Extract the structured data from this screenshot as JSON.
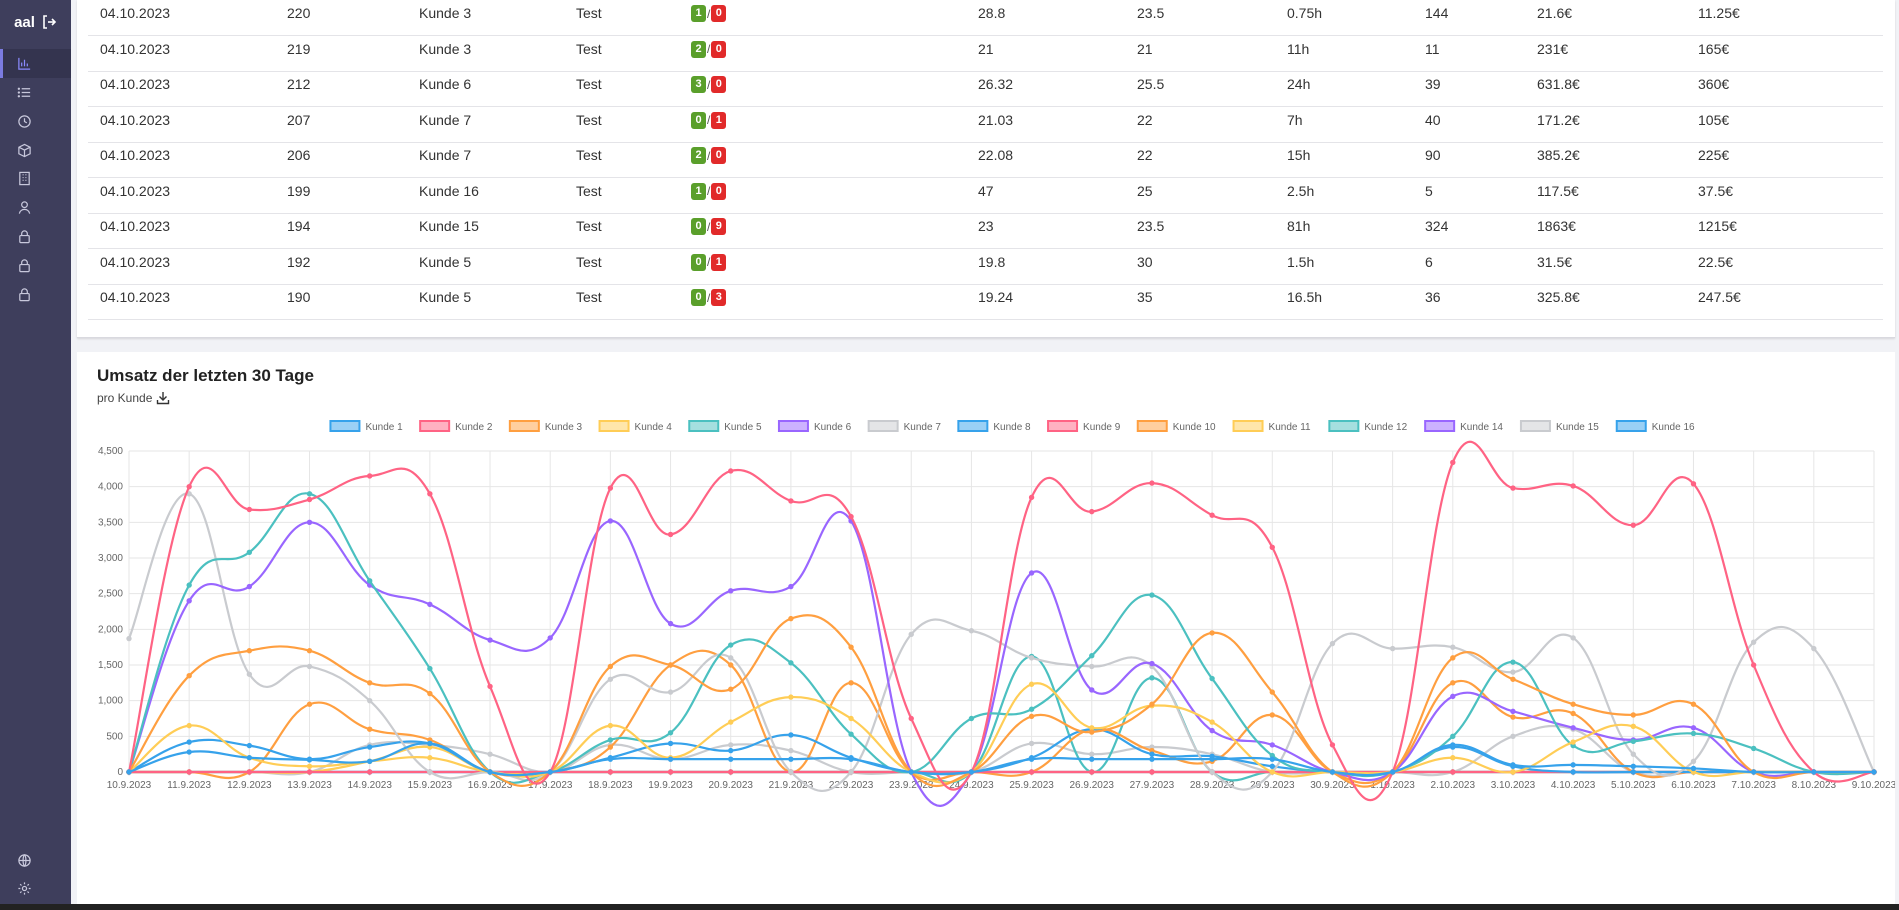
{
  "sidebar": {
    "brand": "aal",
    "items": [
      {
        "icon": "bar-chart-icon",
        "active": true
      },
      {
        "icon": "list-icon",
        "active": false
      },
      {
        "icon": "clock-icon",
        "active": false
      },
      {
        "icon": "box-icon",
        "active": false
      },
      {
        "icon": "building-icon",
        "active": false
      },
      {
        "icon": "user-icon",
        "active": false
      },
      {
        "icon": "lock-icon",
        "active": false
      },
      {
        "icon": "lock-icon",
        "active": false
      },
      {
        "icon": "lock-icon",
        "active": false
      }
    ],
    "bottom_items": [
      {
        "icon": "globe-icon"
      },
      {
        "icon": "gear-icon"
      }
    ]
  },
  "table": {
    "rows": [
      {
        "date": "04.10.2023",
        "id": "220",
        "customer": "Kunde 3",
        "type": "Test",
        "ok": "1",
        "fail": "0",
        "c1": "28.8",
        "c2": "23.5",
        "hours": "0.75h",
        "count": "144",
        "revenue": "21.6€",
        "cost": "11.25€"
      },
      {
        "date": "04.10.2023",
        "id": "219",
        "customer": "Kunde 3",
        "type": "Test",
        "ok": "2",
        "fail": "0",
        "c1": "21",
        "c2": "21",
        "hours": "11h",
        "count": "11",
        "revenue": "231€",
        "cost": "165€"
      },
      {
        "date": "04.10.2023",
        "id": "212",
        "customer": "Kunde 6",
        "type": "Test",
        "ok": "3",
        "fail": "0",
        "c1": "26.32",
        "c2": "25.5",
        "hours": "24h",
        "count": "39",
        "revenue": "631.8€",
        "cost": "360€"
      },
      {
        "date": "04.10.2023",
        "id": "207",
        "customer": "Kunde 7",
        "type": "Test",
        "ok": "0",
        "fail": "1",
        "c1": "21.03",
        "c2": "22",
        "hours": "7h",
        "count": "40",
        "revenue": "171.2€",
        "cost": "105€"
      },
      {
        "date": "04.10.2023",
        "id": "206",
        "customer": "Kunde 7",
        "type": "Test",
        "ok": "2",
        "fail": "0",
        "c1": "22.08",
        "c2": "22",
        "hours": "15h",
        "count": "90",
        "revenue": "385.2€",
        "cost": "225€"
      },
      {
        "date": "04.10.2023",
        "id": "199",
        "customer": "Kunde 16",
        "type": "Test",
        "ok": "1",
        "fail": "0",
        "c1": "47",
        "c2": "25",
        "hours": "2.5h",
        "count": "5",
        "revenue": "117.5€",
        "cost": "37.5€"
      },
      {
        "date": "04.10.2023",
        "id": "194",
        "customer": "Kunde 15",
        "type": "Test",
        "ok": "0",
        "fail": "9",
        "c1": "23",
        "c2": "23.5",
        "hours": "81h",
        "count": "324",
        "revenue": "1863€",
        "cost": "1215€"
      },
      {
        "date": "04.10.2023",
        "id": "192",
        "customer": "Kunde 5",
        "type": "Test",
        "ok": "0",
        "fail": "1",
        "c1": "19.8",
        "c2": "30",
        "hours": "1.5h",
        "count": "6",
        "revenue": "31.5€",
        "cost": "22.5€"
      },
      {
        "date": "04.10.2023",
        "id": "190",
        "customer": "Kunde 5",
        "type": "Test",
        "ok": "0",
        "fail": "3",
        "c1": "19.24",
        "c2": "35",
        "hours": "16.5h",
        "count": "36",
        "revenue": "325.8€",
        "cost": "247.5€"
      }
    ]
  },
  "chart_section": {
    "title": "Umsatz der letzten 30 Tage",
    "subtitle": "pro Kunde",
    "download_icon": "download-icon"
  },
  "chart_data": {
    "type": "line",
    "x": [
      "10.9.2023",
      "11.9.2023",
      "12.9.2023",
      "13.9.2023",
      "14.9.2023",
      "15.9.2023",
      "16.9.2023",
      "17.9.2023",
      "18.9.2023",
      "19.9.2023",
      "20.9.2023",
      "21.9.2023",
      "22.9.2023",
      "23.9.2023",
      "24.9.2023",
      "25.9.2023",
      "26.9.2023",
      "27.9.2023",
      "28.9.2023",
      "29.9.2023",
      "30.9.2023",
      "1.10.2023",
      "2.10.2023",
      "3.10.2023",
      "4.10.2023",
      "5.10.2023",
      "6.10.2023",
      "7.10.2023",
      "8.10.2023",
      "9.10.2023"
    ],
    "ylim": [
      0,
      4500
    ],
    "yticks": [
      "0",
      "500",
      "1,000",
      "1,500",
      "2,000",
      "2,500",
      "3,000",
      "3,500",
      "4,000",
      "4,500"
    ],
    "grid": true,
    "legend_position": "top",
    "series": [
      {
        "name": "Kunde 1",
        "color": "#36a2eb",
        "values": [
          0,
          280,
          200,
          170,
          150,
          400,
          0,
          0,
          180,
          180,
          180,
          180,
          180,
          0,
          0,
          180,
          180,
          180,
          180,
          180,
          0,
          0,
          380,
          100,
          100,
          80,
          50,
          0,
          0,
          0
        ]
      },
      {
        "name": "Kunde 2",
        "color": "#ff6384",
        "values": [
          0,
          4000,
          3680,
          3820,
          4150,
          3900,
          1200,
          0,
          3980,
          3330,
          4220,
          3800,
          3580,
          750,
          0,
          3850,
          3650,
          4050,
          3600,
          3150,
          380,
          0,
          4340,
          3980,
          4010,
          3460,
          4040,
          1500,
          0,
          0
        ]
      },
      {
        "name": "Kunde 3",
        "color": "#ff9f40",
        "values": [
          0,
          1350,
          1700,
          1700,
          1250,
          1100,
          0,
          0,
          1480,
          1500,
          1160,
          2150,
          1750,
          0,
          0,
          780,
          560,
          950,
          1950,
          1120,
          0,
          0,
          1600,
          1300,
          950,
          800,
          950,
          0,
          0,
          0
        ]
      },
      {
        "name": "Kunde 4",
        "color": "#ffcd56",
        "values": [
          0,
          650,
          200,
          80,
          150,
          200,
          0,
          0,
          650,
          200,
          700,
          1050,
          750,
          0,
          0,
          1230,
          620,
          930,
          700,
          0,
          0,
          0,
          200,
          0,
          420,
          640,
          0,
          0,
          0,
          0
        ]
      },
      {
        "name": "Kunde 5",
        "color": "#4bc0c0",
        "values": [
          0,
          2620,
          3080,
          3900,
          2680,
          1450,
          0,
          0,
          450,
          550,
          1780,
          1530,
          530,
          0,
          750,
          880,
          1630,
          2480,
          1310,
          230,
          0,
          0,
          500,
          1540,
          370,
          430,
          540,
          330,
          0,
          0
        ]
      },
      {
        "name": "Kunde 6",
        "color": "#9966ff",
        "values": [
          0,
          2400,
          2600,
          3500,
          2620,
          2350,
          1850,
          1880,
          3520,
          2080,
          2540,
          2600,
          3520,
          0,
          0,
          2790,
          1150,
          1520,
          580,
          380,
          0,
          0,
          1060,
          850,
          620,
          450,
          620,
          0,
          0,
          0
        ]
      },
      {
        "name": "Kunde 7",
        "color": "#c9cbcf",
        "values": [
          1870,
          3900,
          1370,
          1480,
          1000,
          0,
          0,
          0,
          1300,
          1120,
          1600,
          0,
          0,
          1930,
          1980,
          1600,
          1480,
          1480,
          0,
          0,
          1800,
          1730,
          1750,
          1400,
          1880,
          250,
          150,
          1820,
          1730,
          0
        ]
      },
      {
        "name": "Kunde 8",
        "color": "#36a2eb",
        "values": [
          0,
          420,
          370,
          180,
          350,
          400,
          0,
          0,
          200,
          400,
          300,
          520,
          200,
          0,
          0,
          200,
          600,
          250,
          220,
          80,
          0,
          0,
          350,
          80,
          0,
          0,
          0,
          0,
          0,
          0
        ]
      },
      {
        "name": "Kunde 9",
        "color": "#ff6384",
        "values": [
          0,
          0,
          0,
          0,
          0,
          0,
          0,
          0,
          0,
          0,
          0,
          0,
          0,
          0,
          0,
          0,
          0,
          0,
          0,
          0,
          0,
          0,
          0,
          0,
          0,
          0,
          0,
          0,
          0,
          0
        ]
      },
      {
        "name": "Kunde 10",
        "color": "#ff9f40",
        "values": [
          0,
          0,
          0,
          950,
          600,
          450,
          0,
          0,
          350,
          1500,
          1500,
          0,
          1250,
          0,
          0,
          0,
          600,
          300,
          150,
          800,
          0,
          0,
          1250,
          770,
          820,
          0,
          0,
          0,
          0,
          0
        ]
      },
      {
        "name": "Kunde 11",
        "color": "#ffcd56",
        "values": [
          0,
          0,
          0,
          0,
          150,
          350,
          0,
          0,
          0,
          0,
          0,
          0,
          0,
          0,
          0,
          0,
          0,
          0,
          0,
          0,
          0,
          0,
          0,
          0,
          0,
          0,
          0,
          0,
          0,
          0
        ]
      },
      {
        "name": "Kunde 12",
        "color": "#4bc0c0",
        "values": [
          0,
          0,
          0,
          0,
          0,
          0,
          0,
          0,
          0,
          0,
          0,
          0,
          0,
          0,
          0,
          1620,
          0,
          1320,
          0,
          0,
          0,
          0,
          0,
          0,
          0,
          0,
          0,
          0,
          0,
          0
        ]
      },
      {
        "name": "Kunde 14",
        "color": "#9966ff",
        "values": [
          0,
          0,
          0,
          0,
          0,
          0,
          0,
          0,
          0,
          0,
          0,
          0,
          0,
          0,
          0,
          0,
          0,
          0,
          0,
          0,
          0,
          0,
          0,
          0,
          0,
          0,
          0,
          0,
          0,
          0
        ]
      },
      {
        "name": "Kunde 15",
        "color": "#c9cbcf",
        "values": [
          0,
          0,
          0,
          0,
          380,
          380,
          250,
          0,
          380,
          180,
          380,
          300,
          0,
          0,
          0,
          400,
          250,
          350,
          250,
          0,
          0,
          0,
          0,
          500,
          600,
          0,
          0,
          0,
          0,
          0
        ]
      },
      {
        "name": "Kunde 16",
        "color": "#36a2eb",
        "values": [
          0,
          0,
          0,
          0,
          0,
          0,
          0,
          0,
          0,
          0,
          0,
          0,
          0,
          0,
          0,
          0,
          0,
          0,
          0,
          0,
          0,
          0,
          0,
          0,
          0,
          0,
          0,
          0,
          0,
          0
        ]
      }
    ]
  }
}
